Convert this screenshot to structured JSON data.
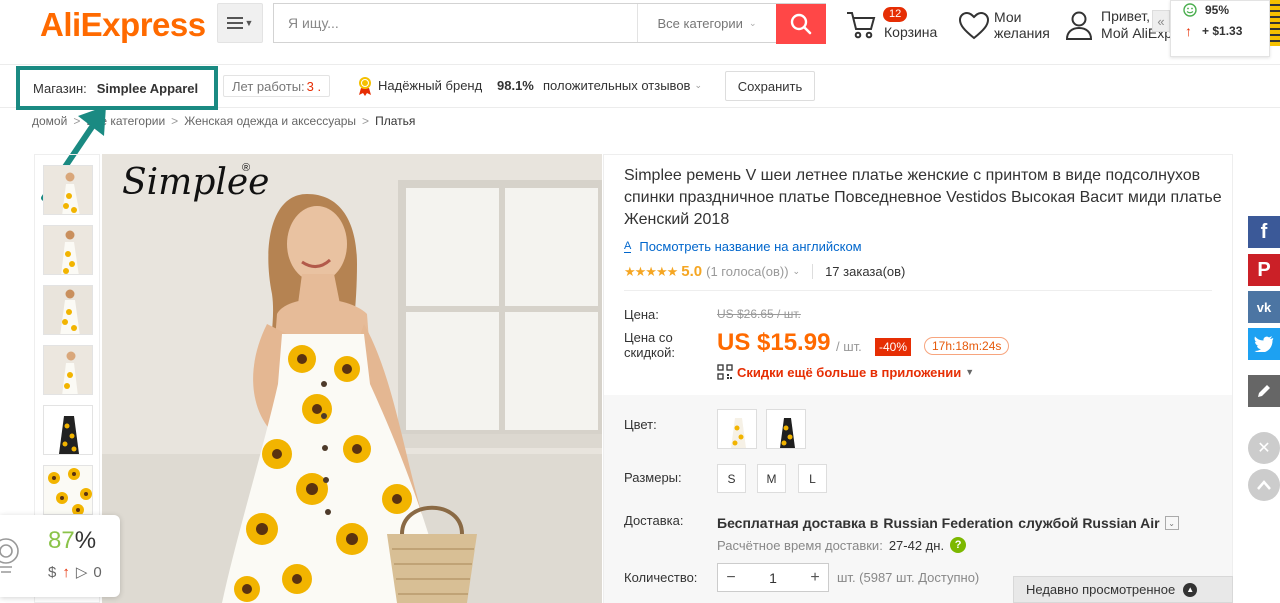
{
  "header": {
    "logo": "AliExpress",
    "search_placeholder": "Я ищу...",
    "category": "Все категории",
    "cart_count": "12",
    "cart_label": "Корзина",
    "wishlist_line1": "Мои",
    "wishlist_line2": "желания",
    "user_line1": "Привет,",
    "user_line2": "Мой AliExpress"
  },
  "extension": {
    "rating": "95%",
    "price_change": "+ $1.33"
  },
  "store": {
    "label": "Магазин:",
    "name": "Simplee Apparel",
    "years_label": "Лет работы:",
    "years_value": "3 .",
    "brand_label": "Надёжный бренд",
    "feedback_pct": "98.1%",
    "feedback_label": "положительных отзывов",
    "save_label": "Сохранить"
  },
  "breadcrumb": {
    "items": [
      "домой",
      "Все категории",
      "Женская одежда и аксессуары",
      "Платья"
    ]
  },
  "product": {
    "brand_watermark": "Simplee",
    "title": "Simplee ремень V шеи летнее платье женские с принтом в виде подсолнухов спинки праздничное платье Повседневное Vestidos Высокая Васит миди платье Женский 2018",
    "translate_link": "Посмотреть название на английском",
    "translate_ai": "A",
    "rating_value": "5.0",
    "rating": 5.0,
    "votes": "(1 голоса(ов))",
    "orders": "17 заказа(ов)",
    "price_label": "Цена:",
    "old_price": "US $26.65 / шт.",
    "discount_price_label": "Цена со скидкой:",
    "new_price": "US $15.99",
    "per_unit": "/ шт.",
    "discount": "-40%",
    "timer": "17h:18m:24s",
    "app_deal": "Скидки ещё больше в приложении",
    "color_label": "Цвет:",
    "sizes_label": "Размеры:",
    "sizes": [
      "S",
      "M",
      "L"
    ],
    "shipping_label": "Доставка:",
    "shipping_prefix": "Бесплатная доставка в",
    "shipping_country": "Russian Federation",
    "shipping_service": "службой Russian Air",
    "shipping_time_label": "Расчётное время доставки:",
    "shipping_days": "27-42 дн.",
    "quantity_label": "Количество:",
    "quantity_value": "1",
    "stock_note": "шт. (5987 шт. Доступно)"
  },
  "recently_viewed": "Недавно просмотренное",
  "bottom_widget": {
    "pct": "87",
    "pct_sign": "%",
    "dollar": "$",
    "count": "0"
  },
  "colors": {
    "accent": "#ff6a00",
    "search_btn": "#ff4747",
    "annotation": "#1a8a82",
    "facebook": "#3b5998",
    "pinterest": "#cb2027",
    "vk": "#4c75a3",
    "twitter": "#1da1f2"
  }
}
